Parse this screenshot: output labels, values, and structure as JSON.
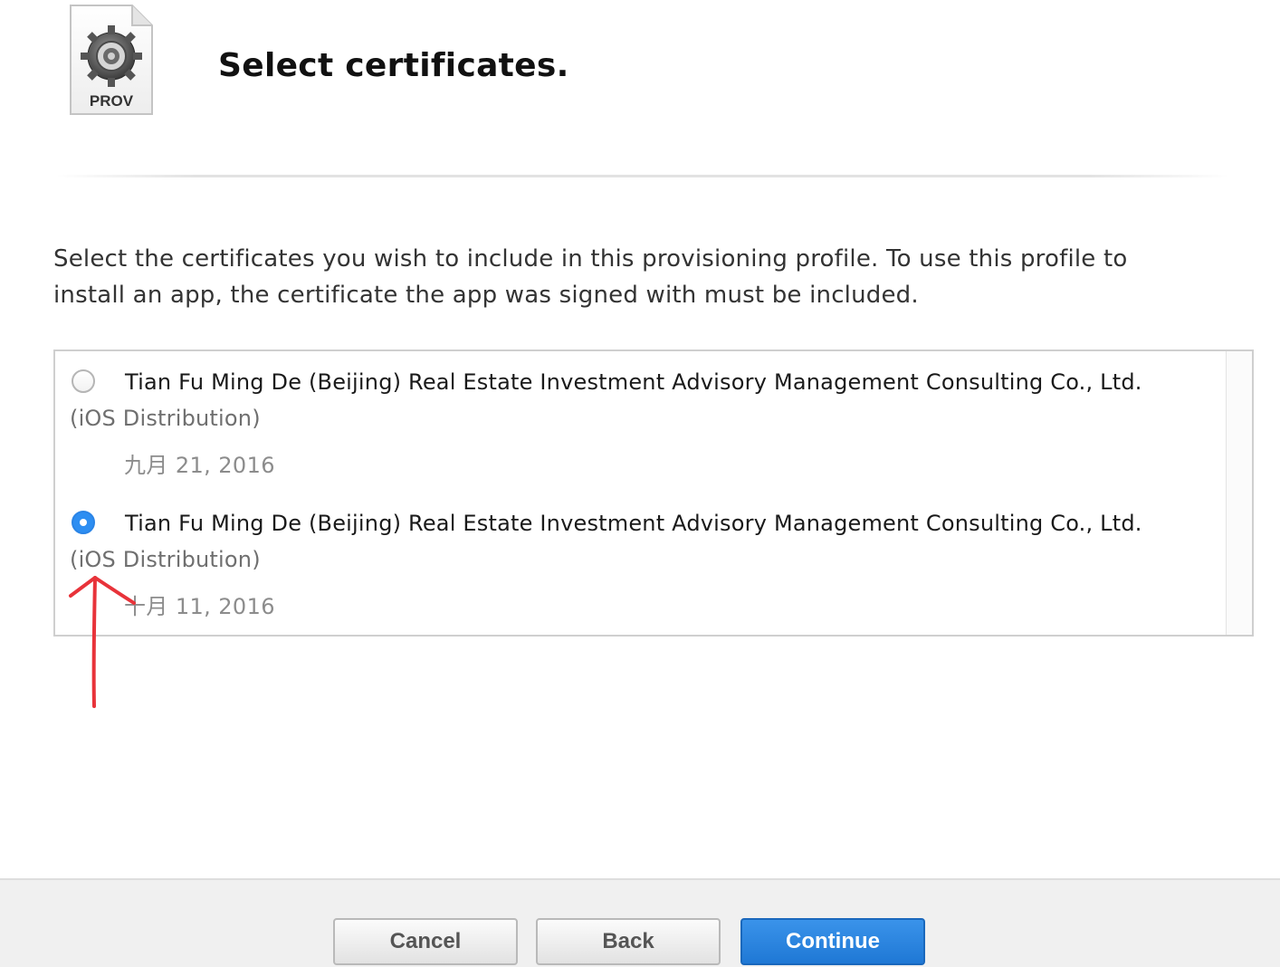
{
  "header": {
    "icon_label": "PROV",
    "title": "Select certificates."
  },
  "description": "Select the certificates you wish to include in this provisioning profile. To use this profile to\ninstall an app, the certificate the app was signed with must be included.",
  "certificates": [
    {
      "name": "Tian Fu Ming De (Beijing) Real Estate Investment Advisory Management Consulting Co., Ltd.",
      "type": "(iOS Distribution)",
      "date": "九月 21, 2016",
      "selected": false
    },
    {
      "name": "Tian Fu Ming De (Beijing) Real Estate Investment Advisory Management Consulting Co., Ltd.",
      "type": "(iOS Distribution)",
      "date": "十月 11, 2016",
      "selected": true
    }
  ],
  "footer": {
    "cancel_label": "Cancel",
    "back_label": "Back",
    "continue_label": "Continue"
  },
  "colors": {
    "accent": "#2d8ef2",
    "annotation": "#e8333a"
  }
}
